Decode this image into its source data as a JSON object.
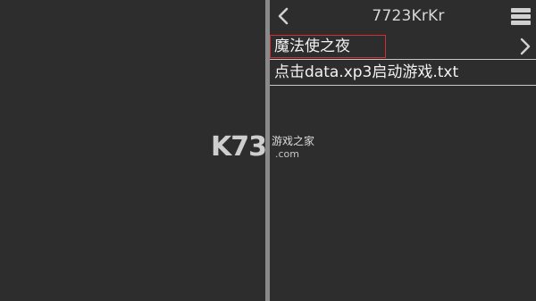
{
  "header": {
    "title": "7723KrKr",
    "back_icon": "chevron-left-icon",
    "menu_icon": "hamburger-menu-icon"
  },
  "list": {
    "items": [
      {
        "label": "魔法使之夜",
        "icon": "chevron-right-icon",
        "highlighted": true
      },
      {
        "label": "点击data.xp3启动游戏.txt"
      }
    ]
  },
  "watermark": {
    "logo": "K73",
    "cn_text": "游戏之家",
    "domain": ".com"
  },
  "colors": {
    "background": "#2d2d2d",
    "divider": "#8a8a8a",
    "highlight_border": "#d03030",
    "text": "#f2f2f2"
  }
}
